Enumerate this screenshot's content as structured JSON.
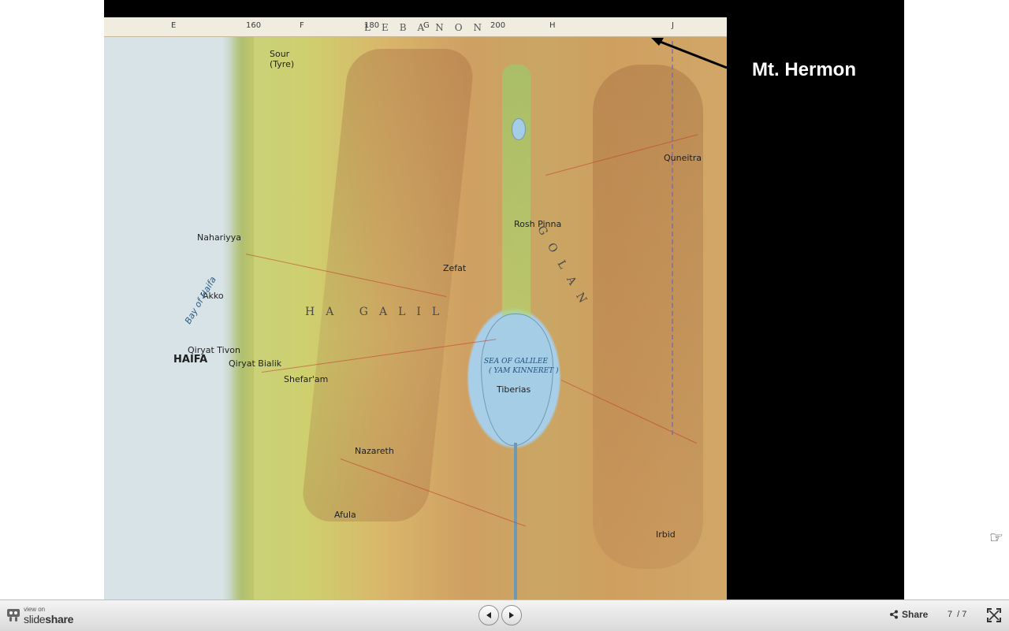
{
  "slide": {
    "annotation": "Mt. Hermon",
    "map": {
      "country_label": "LEBANON",
      "grid_letters": [
        "E",
        "F",
        "G",
        "H",
        "J"
      ],
      "grid_numbers": [
        "160",
        "180",
        "200"
      ],
      "places": {
        "sour": "Sour (Tyre)",
        "nahariyya": "Nahariyya",
        "akko": "'Akko",
        "haifa": "HAIFA",
        "zefat": "Zefat",
        "tiberias": "Tiberias",
        "qiryat_tivon": "Qiryat Tivon",
        "qiryat_bialik": "Qiryat Bialik",
        "shefaram": "Shefar'am",
        "nazareth": "Nazareth",
        "afula": "Afula",
        "qunaitra": "Quneitra",
        "irbid": "Irbid",
        "rosh_pinna": "Rosh Pinna"
      },
      "regions": {
        "hagalil": "HA GALIL",
        "golan": "GOLAN",
        "bay": "Bay of Haifa"
      },
      "lake": {
        "name": "SEA OF GALILEE",
        "sub": "( YAM KINNERET )"
      }
    }
  },
  "toolbar": {
    "view_on": "view on",
    "brand_light": "slide",
    "brand_bold": "share",
    "share_label": "Share",
    "current_page": "7",
    "total_pages": "/ 7"
  }
}
